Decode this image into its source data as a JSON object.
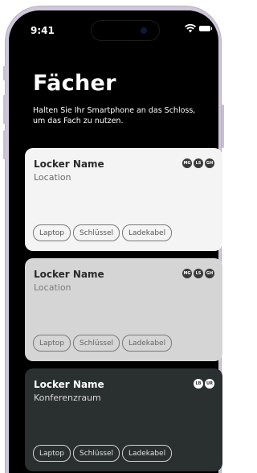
{
  "status": {
    "time": "9:41",
    "icons": [
      "wifi-icon",
      "battery-icon"
    ]
  },
  "header": {
    "title": "Fächer",
    "subtitle": "Halten Sie Ihr Smartphone an das Schloss, um das Fach zu nutzen."
  },
  "colors": {
    "background": "#000000",
    "card_light": "#f4f4f4",
    "card_gray": "#d5d5d5",
    "card_dark": "#2a2f30"
  },
  "lockers": [
    {
      "name": "Locker Name",
      "location": "Location",
      "badges": [
        "MG",
        "LS",
        "GH"
      ],
      "items": [
        "Laptop",
        "Schlüssel",
        "Ladekabel"
      ]
    },
    {
      "name": "Locker Name",
      "location": "Location",
      "badges": [
        "MG",
        "LS",
        "GH"
      ],
      "items": [
        "Laptop",
        "Schlüssel",
        "Ladekabel"
      ]
    },
    {
      "name": "Locker Name",
      "location": "Konferenzraum",
      "badges": [
        "LB",
        "UR"
      ],
      "items": [
        "Laptop",
        "Schlüssel",
        "Ladekabel"
      ]
    }
  ]
}
